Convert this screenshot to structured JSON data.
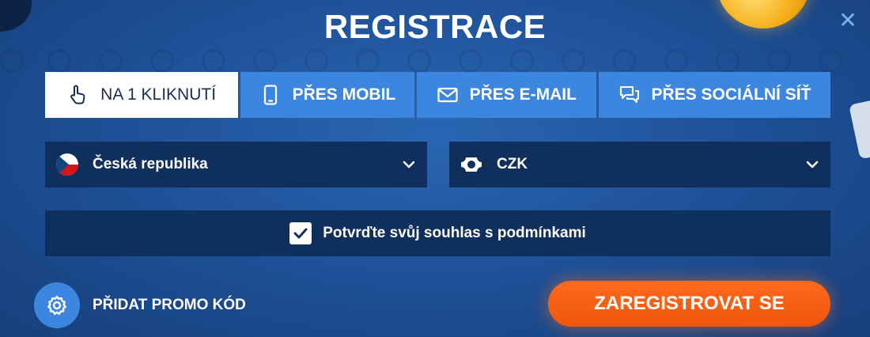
{
  "title": "REGISTRACE",
  "close_glyph": "✕",
  "tabs": [
    {
      "label": "NA 1 KLIKNUTÍ",
      "icon": "pointer-hand-icon",
      "active": true
    },
    {
      "label": "PŘES MOBIL",
      "icon": "mobile-phone-icon",
      "active": false
    },
    {
      "label": "PŘES E-MAIL",
      "icon": "envelope-icon",
      "active": false
    },
    {
      "label": "PŘES SOCIÁLNÍ SÍŤ",
      "icon": "chat-bubbles-icon",
      "active": false
    }
  ],
  "country_select": {
    "value": "Česká republika",
    "icon": "czech-flag-icon"
  },
  "currency_select": {
    "value": "CZK",
    "icon": "banknote-icon"
  },
  "consent": {
    "label": "Potvrďte svůj souhlas s podmínkami",
    "checked": true
  },
  "promo": {
    "label": "PŘIDAT PROMO KÓD",
    "icon": "gear-icon"
  },
  "submit": {
    "label": "ZAREGISTROVAT SE"
  },
  "colors": {
    "background": "#1d4f95",
    "tab": "#3d86e0",
    "field": "#0f2f5c",
    "submit": "#f0560a"
  }
}
